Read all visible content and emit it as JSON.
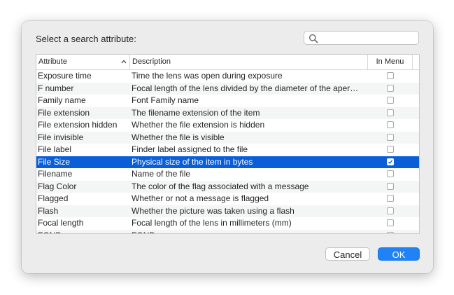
{
  "dialog": {
    "prompt": "Select a search attribute:",
    "search": {
      "value": "",
      "placeholder": ""
    }
  },
  "table": {
    "columns": {
      "attribute": "Attribute",
      "description": "Description",
      "in_menu": "In Menu"
    },
    "sort": {
      "column": "attribute",
      "direction": "ascending"
    },
    "rows": [
      {
        "attribute": "Exposure time",
        "description": "Time the lens was open during exposure",
        "in_menu": false
      },
      {
        "attribute": "F number",
        "description": "Focal length of the lens divided by the diameter of the aper…",
        "in_menu": false
      },
      {
        "attribute": "Family name",
        "description": "Font Family name",
        "in_menu": false
      },
      {
        "attribute": "File extension",
        "description": "The filename extension of the item",
        "in_menu": false
      },
      {
        "attribute": "File extension hidden",
        "description": "Whether the file extension is hidden",
        "in_menu": false
      },
      {
        "attribute": "File invisible",
        "description": "Whether the file is visible",
        "in_menu": false
      },
      {
        "attribute": "File label",
        "description": "Finder label assigned to the file",
        "in_menu": false
      },
      {
        "attribute": "File Size",
        "description": "Physical size of the item in bytes",
        "in_menu": true,
        "selected": true
      },
      {
        "attribute": "Filename",
        "description": "Name of the file",
        "in_menu": false
      },
      {
        "attribute": "Flag Color",
        "description": "The color of the flag associated with a message",
        "in_menu": false
      },
      {
        "attribute": "Flagged",
        "description": "Whether or not a message is flagged",
        "in_menu": false
      },
      {
        "attribute": "Flash",
        "description": "Whether the picture was taken using a flash",
        "in_menu": false
      },
      {
        "attribute": "Focal length",
        "description": "Focal length of the lens in millimeters (mm)",
        "in_menu": false
      },
      {
        "attribute": "FOND name",
        "description": "FOND name",
        "in_menu": false
      }
    ]
  },
  "buttons": {
    "cancel": "Cancel",
    "ok": "OK"
  },
  "colors": {
    "selection": "#0a5fd8",
    "default_button": "#1f82f5"
  },
  "icons": {
    "search": "search-icon",
    "sort": "chevron-up-icon",
    "check": "checkmark-icon"
  }
}
